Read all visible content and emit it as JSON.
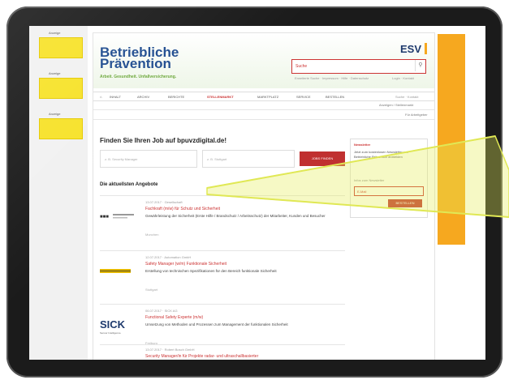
{
  "ads": {
    "label": "Anzeige"
  },
  "header": {
    "logo_line1": "Betriebliche",
    "logo_line2": "Prävention",
    "tagline": "Arbeit. Gesundheit. Unfallversicherung.",
    "brand": "ESV",
    "search_placeholder": "Suche",
    "links_left": "Erweiterte Suche · Impressum · Hilfe · Datenschutz",
    "links_right": "Login · Kontakt"
  },
  "nav": {
    "items": [
      "INHALT",
      "ARCHIV",
      "BERICHTE",
      "STELLENMARKT",
      "MARKTPLATZ",
      "SERVICE",
      "BESTELLEN"
    ],
    "active": "STELLENMARKT",
    "right": "Suche · Kontakt"
  },
  "subnav": {
    "item1": "Anzeigen / Stellenmarkt",
    "item2": "Für Arbeitgeber"
  },
  "jobsearch": {
    "title": "Finden Sie Ihren Job auf bpuvzdigital.de!",
    "what_placeholder": "z. B. Security Manager",
    "where_placeholder": "z. B. Stuttgart",
    "button": "JOBS FINDEN"
  },
  "listings": {
    "title": "Die aktuellsten Angebote",
    "jobs": [
      {
        "meta": "13.07.2017 · Gesellschaft",
        "title": "Fachkraft (m/w) für Schutz und Sicherheit",
        "desc": "Gewährleistung der Sicherheit (Erste Hilfe / Brandschutz / Arbeitsschutz) der Mitarbeiter, Kunden und Besucher",
        "loc": "Munchen"
      },
      {
        "meta": "12.07.2017 · Automation GmbH",
        "title": "Safety Manager (w/m) Funktionale Sicherheit",
        "desc": "Erstellung von technischen Spezifikationen für den Bereich funktionale Sicherheit",
        "loc": "Stuttgart"
      },
      {
        "meta": "06.07.2017 · SICK AG",
        "title": "Functional Safety Experte (m/w)",
        "desc": "Umsetzung von Methoden und Prozessen zum Management der funktionalen Sicherheit",
        "loc": "Freiburg"
      },
      {
        "meta": "13.07.2017 · Robert Bosch GmbH",
        "title": "Security Manager/in für Projekte radar- und ultraschallbasierter",
        "desc": "",
        "loc": ""
      }
    ],
    "sick_logo": "SICK",
    "sick_sub": "Sensor Intelligence."
  },
  "newsletter": {
    "title": "Newsletter",
    "text": "Jetzt zum kostenlosen Newsletter von Betriebliche Prävention anmelden",
    "link": "Infos zum Newsletter",
    "email_placeholder": "E-Mail",
    "button": "BESTELLEN"
  },
  "colors": {
    "accent_red": "#c03030",
    "brand_blue": "#1e4b8f",
    "ad_yellow": "#f7e229",
    "ad_orange": "#f6a81f"
  }
}
